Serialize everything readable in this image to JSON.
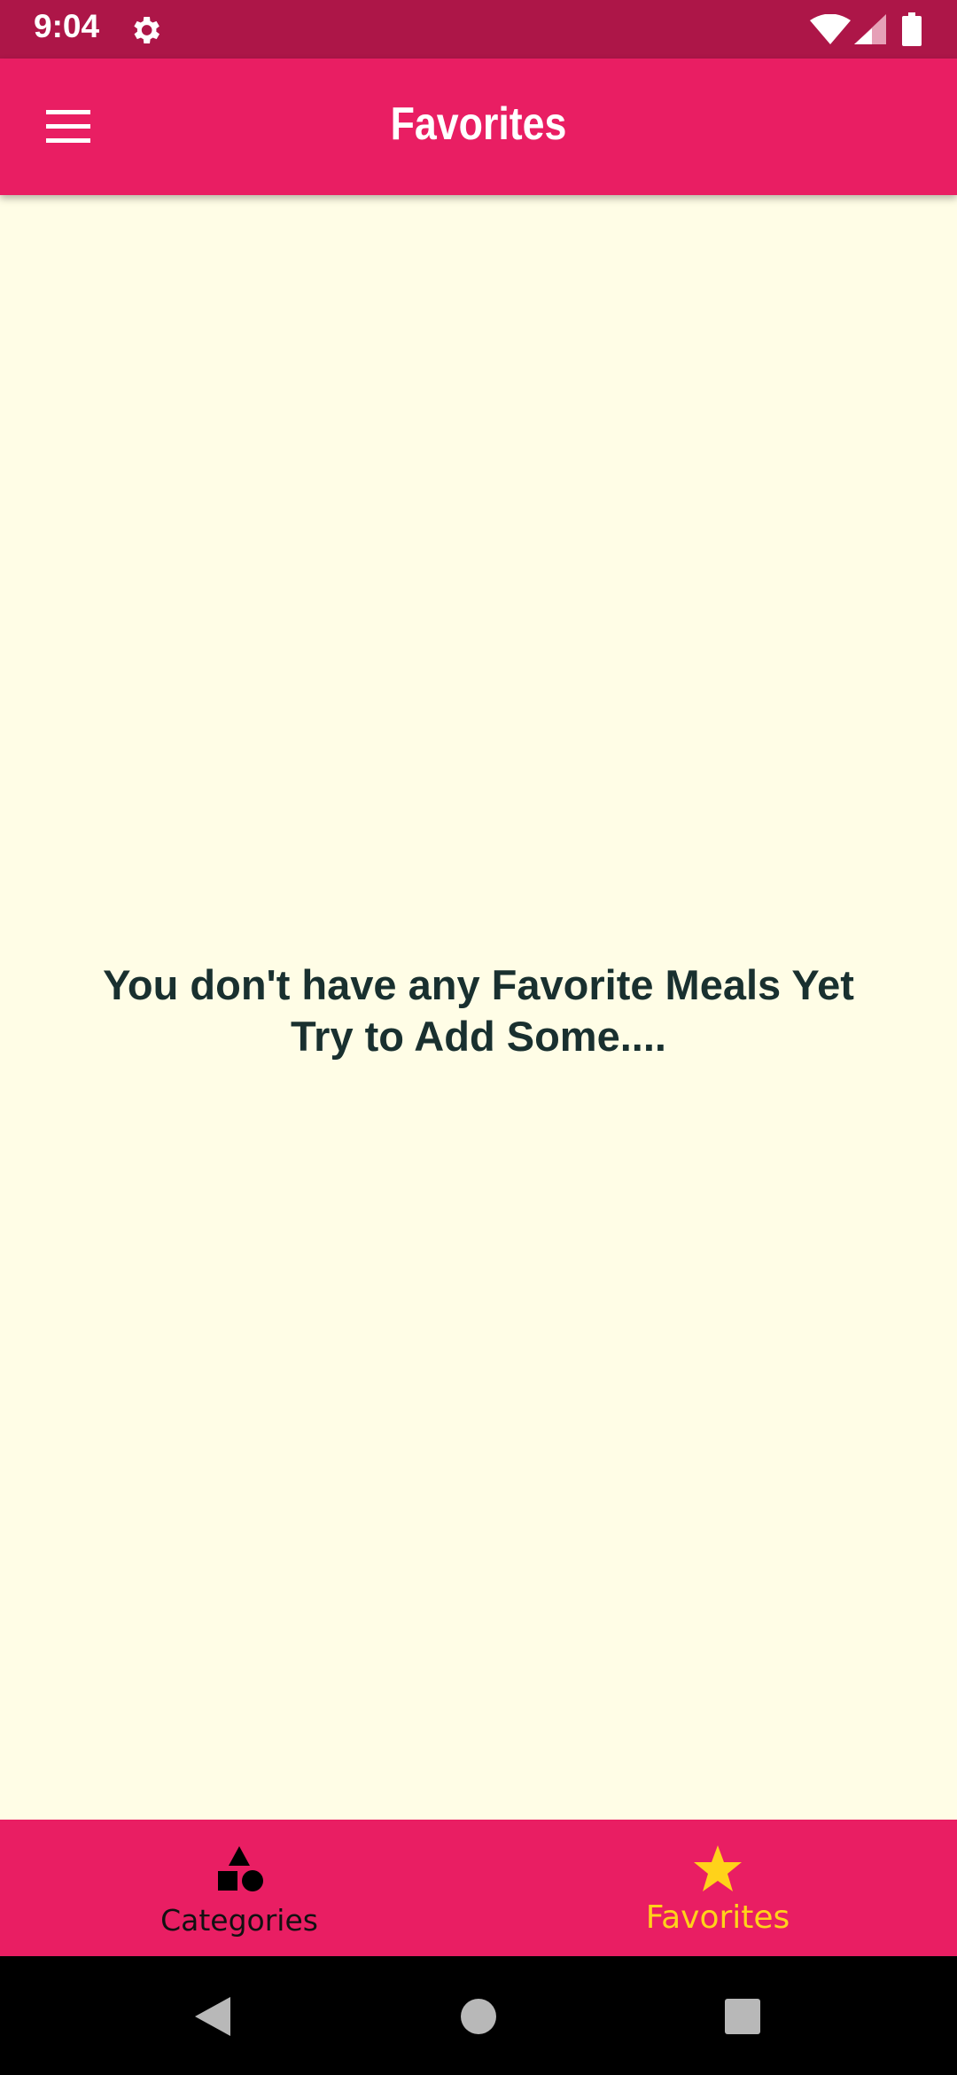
{
  "status_bar": {
    "time": "9:04",
    "icons": [
      "settings-icon",
      "wifi-icon",
      "signal-icon",
      "battery-icon"
    ]
  },
  "app_bar": {
    "title": "Favorites",
    "menu_icon": "menu-icon"
  },
  "content": {
    "empty_line_1": "You don't have any Favorite Meals Yet",
    "empty_line_2": "Try to Add Some...."
  },
  "bottom_nav": {
    "items": [
      {
        "label": "Categories",
        "icon": "categories-icon",
        "selected": false
      },
      {
        "label": "Favorites",
        "icon": "star-icon",
        "selected": true
      }
    ]
  },
  "system_nav": {
    "icons": [
      "back-icon",
      "home-icon",
      "recents-icon"
    ]
  },
  "colors": {
    "status_bar": "#ad1648",
    "primary": "#e91e63",
    "background": "#fffde6",
    "text": "#19302f",
    "accent": "#ffd21a"
  }
}
